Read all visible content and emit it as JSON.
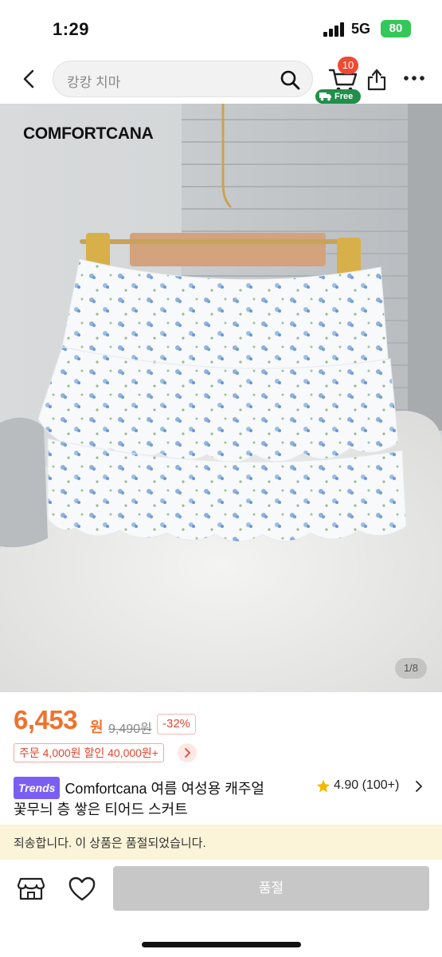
{
  "status_bar": {
    "time": "1:29",
    "network": "5G",
    "battery": "80"
  },
  "header": {
    "search_placeholder": "캉캉 치마",
    "cart_count": "10",
    "free_label": "Free"
  },
  "product": {
    "image": {
      "brand_text": "COMFORTCANA",
      "page_indicator": "1/8"
    },
    "price": "6,453",
    "price_unit": "원",
    "original_price": "9,490원",
    "discount": "-32%",
    "coupon": "주문 4,000원 할인 40,000원+",
    "trends_badge": "Trends",
    "title_line1": "Comfortcana 여름 여성용 캐주얼",
    "title_line2": "꽃무늬 층 쌓은 티어드 스커트",
    "rating": "4.90 (100+)"
  },
  "notice": {
    "text": "죄송합니다. 이 상품은 품절되었습니다."
  },
  "bottom_bar": {
    "soldout_label": "품절"
  },
  "colors": {
    "price": "#f0712c",
    "discount": "#e4462f",
    "trends": "#7b5ff2",
    "free": "#1f8f4a",
    "notice_bg": "#fbf4d9",
    "soldout_bg": "#c7c7c7"
  }
}
